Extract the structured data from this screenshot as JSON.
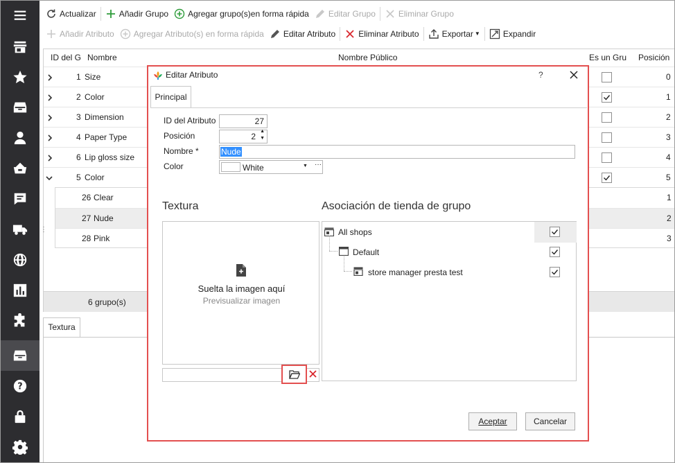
{
  "toolbar1": {
    "refresh": "Actualizar",
    "add_group": "Añadir Grupo",
    "quick_add_groups": "Agregar grupo(s)en forma rápida",
    "edit_group": "Editar Grupo",
    "delete_group": "Eliminar Grupo"
  },
  "toolbar2": {
    "add_attribute": "Añadir Atributo",
    "quick_add_attributes": "Agregar Atributo(s) en forma rápida",
    "edit_attribute": "Editar Atributo",
    "delete_attribute": "Eliminar Atributo",
    "export": "Exportar",
    "expand": "Expandir"
  },
  "grid": {
    "headers": {
      "id": "ID del G",
      "name": "Nombre",
      "public_name": "Nombre Público",
      "is_color_group": "Es un Gru",
      "position": "Posición"
    },
    "rows": [
      {
        "id": "1",
        "name": "Size",
        "is_color": false,
        "position": "0"
      },
      {
        "id": "2",
        "name": "Color",
        "is_color": true,
        "position": "1"
      },
      {
        "id": "3",
        "name": "Dimension",
        "is_color": false,
        "position": "2"
      },
      {
        "id": "4",
        "name": "Paper Type",
        "is_color": false,
        "position": "3"
      },
      {
        "id": "6",
        "name": "Lip gloss size",
        "is_color": false,
        "position": "4"
      },
      {
        "id": "5",
        "name": "Color",
        "is_color": true,
        "position": "5"
      }
    ],
    "child_rows": [
      {
        "id": "26",
        "name": "Clear",
        "position": "1"
      },
      {
        "id": "27",
        "name": "Nude",
        "position": "2"
      },
      {
        "id": "28",
        "name": "Pink",
        "position": "3"
      }
    ],
    "footer_count": "6 grupo(s)"
  },
  "bottom_tab": "Textura",
  "dialog": {
    "title": "Editar Atributo",
    "help": "?",
    "tab": "Principal",
    "id_label": "ID del Atributo",
    "id_value": "27",
    "position_label": "Posición",
    "position_value": "2",
    "name_label": "Nombre *",
    "name_value": "Nude",
    "color_label": "Color",
    "color_value": "White",
    "color_more": "···",
    "texture_heading": "Textura",
    "drop_text": "Suelta la imagen aquí",
    "preview_text": "Previsualizar imagen",
    "shop_heading": "Asociación de tienda de grupo",
    "shops": [
      {
        "label": "All shops",
        "checked": true
      },
      {
        "label": "Default",
        "checked": true
      },
      {
        "label": "store manager presta test",
        "checked": true
      }
    ],
    "accept": "Aceptar",
    "cancel": "Cancelar"
  }
}
